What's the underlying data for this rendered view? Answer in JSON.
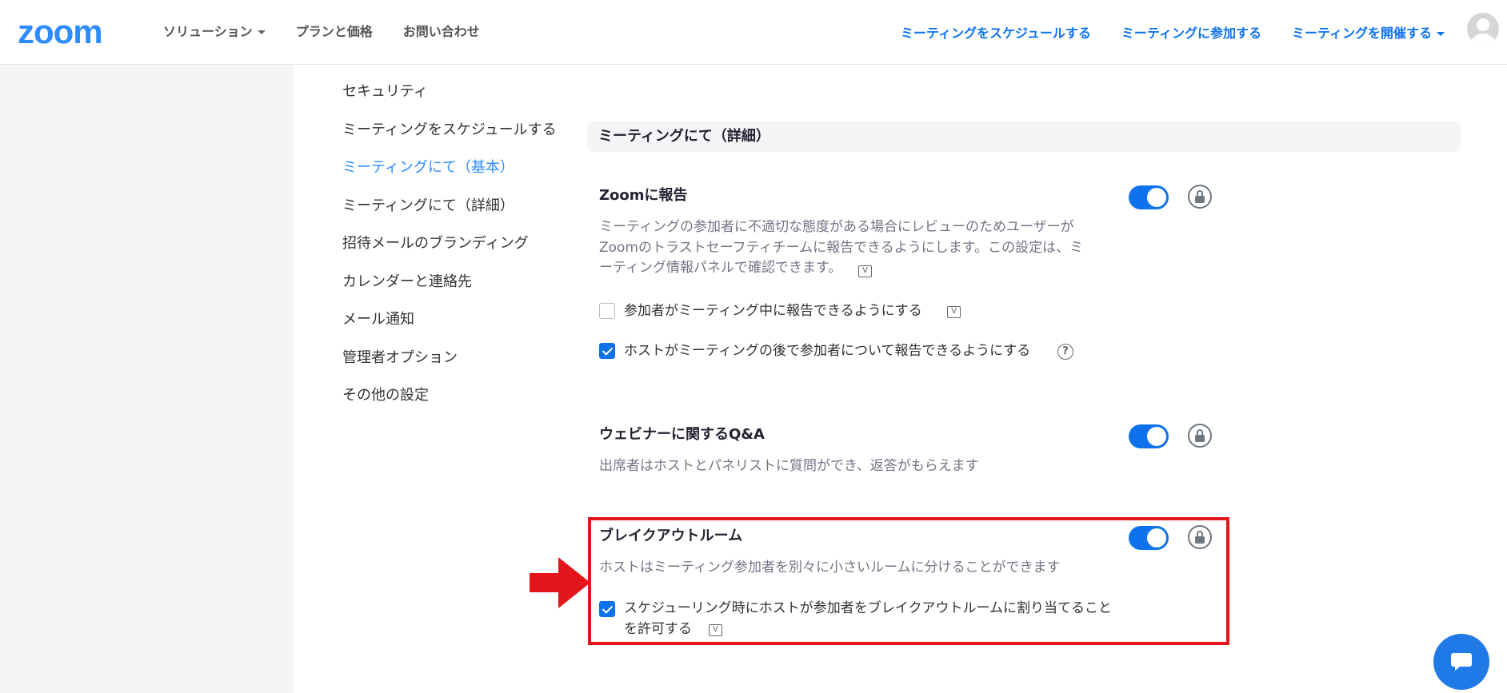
{
  "header": {
    "logo": "zoom",
    "nav_left": [
      {
        "label": "ソリューション",
        "has_caret": true
      },
      {
        "label": "プランと価格",
        "has_caret": false
      },
      {
        "label": "お問い合わせ",
        "has_caret": false
      }
    ],
    "nav_right": [
      {
        "label": "ミーティングをスケジュールする",
        "has_caret": false
      },
      {
        "label": "ミーティングに参加する",
        "has_caret": false
      },
      {
        "label": "ミーティングを開催する",
        "has_caret": true
      }
    ]
  },
  "sidebar": {
    "items": [
      {
        "label": "セキュリティ",
        "active": false
      },
      {
        "label": "ミーティングをスケジュールする",
        "active": false
      },
      {
        "label": "ミーティングにて（基本）",
        "active": true
      },
      {
        "label": "ミーティングにて（詳細）",
        "active": false
      },
      {
        "label": "招待メールのブランディング",
        "active": false
      },
      {
        "label": "カレンダーと連絡先",
        "active": false
      },
      {
        "label": "メール通知",
        "active": false
      },
      {
        "label": "管理者オプション",
        "active": false
      },
      {
        "label": "その他の設定",
        "active": false
      }
    ]
  },
  "section": {
    "title": "ミーティングにて（詳細）"
  },
  "settings": {
    "report": {
      "title": "Zoomに報告",
      "desc_line1": "ミーティングの参加者に不適切な態度がある場合にレビューのためユーザーが",
      "desc_line2": "Zoomのトラストセーフティチームに報告できるようにします。この設定は、ミ",
      "desc_line3": "ーティング情報パネルで確認できます。",
      "enabled": true,
      "option1": {
        "label": "参加者がミーティング中に報告できるようにする",
        "checked": false
      },
      "option2": {
        "label": "ホストがミーティングの後で参加者について報告できるようにする",
        "checked": true
      }
    },
    "qa": {
      "title": "ウェビナーに関するQ&A",
      "desc": "出席者はホストとパネリストに質問ができ、返答がもらえます",
      "enabled": true
    },
    "breakout": {
      "title": "ブレイクアウトルーム",
      "desc": "ホストはミーティング参加者を別々に小さいルームに分けることができます",
      "enabled": true,
      "option": {
        "label_line1": "スケジューリング時にホストが参加者をブレイクアウトルームに割り当てること",
        "label_line2": "を許可する",
        "checked": true
      }
    }
  },
  "icons": {
    "v_icon_glyph": "V",
    "help_icon_glyph": "?"
  },
  "colors": {
    "brand": "#2D8CFF",
    "link": "#0E72ED",
    "toggle_on": "#0E72ED",
    "highlight": "#e4151b"
  }
}
